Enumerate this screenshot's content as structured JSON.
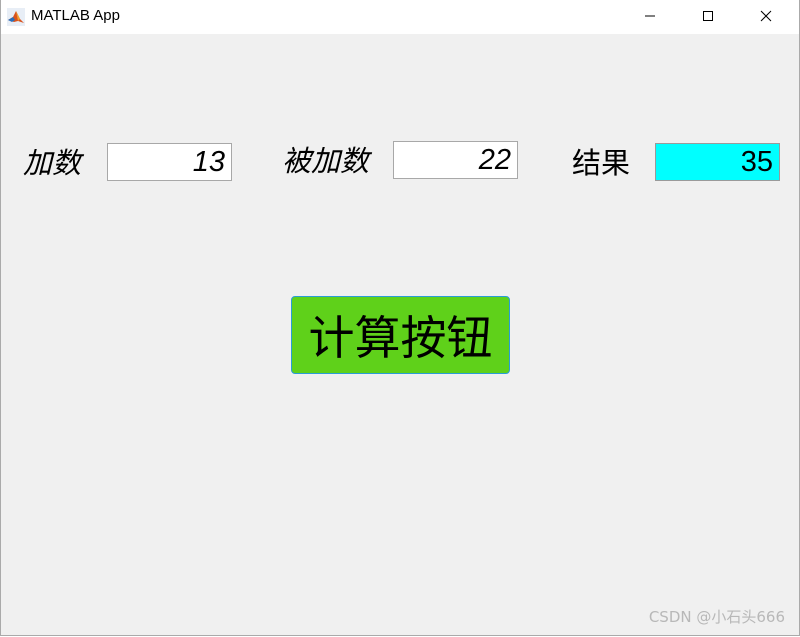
{
  "window": {
    "title": "MATLAB App",
    "controls": [
      "minimize-icon",
      "maximize-icon",
      "close-icon"
    ]
  },
  "form": {
    "addend_label": "加数",
    "addend_value": "13",
    "augend_label": "被加数",
    "augend_value": "22",
    "result_label": "结果",
    "result_value": "35",
    "result_background": "#00ffff"
  },
  "button": {
    "label": "计算按钮",
    "background": "#5fd11a",
    "border": "#2a9dd6"
  },
  "watermark": "CSDN @小石头666",
  "colors": {
    "window_background": "#f0f0f0",
    "titlebar_background": "#ffffff"
  }
}
